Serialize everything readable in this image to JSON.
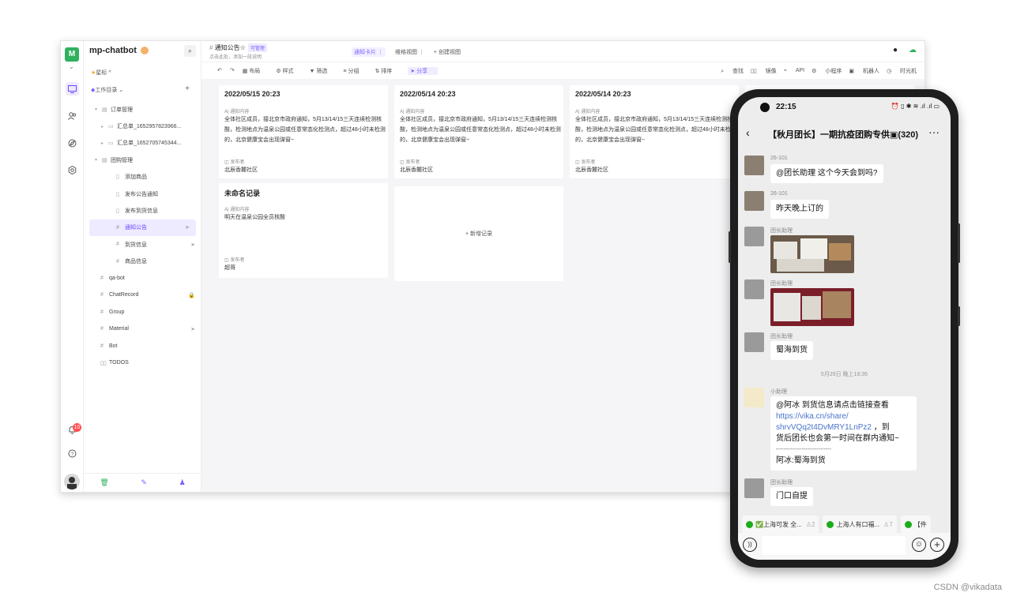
{
  "app": {
    "space_name": "mp-chatbot",
    "logo_letter": "M",
    "star_label": "星标 ^",
    "workdir_label": "工作目录",
    "notification_count": "10"
  },
  "tree": [
    {
      "label": "订单管理",
      "level": 1,
      "expand": "▾",
      "icon": "▤"
    },
    {
      "label": "汇总单_1652957823966...",
      "level": 2,
      "expand": "▸",
      "icon": "▭"
    },
    {
      "label": "汇总单_1652705745344...",
      "level": 2,
      "expand": "▸",
      "icon": "▭"
    },
    {
      "label": "团购管理",
      "level": 1,
      "expand": "▾",
      "icon": "▤"
    },
    {
      "label": "添加商品",
      "level": 3,
      "expand": "",
      "icon": "▯"
    },
    {
      "label": "发布公告通知",
      "level": 3,
      "expand": "",
      "icon": "▯"
    },
    {
      "label": "发布到货信息",
      "level": 3,
      "expand": "",
      "icon": "▯"
    },
    {
      "label": "通知公告",
      "level": 3,
      "expand": "",
      "icon": "#",
      "active": true,
      "tail": "➤"
    },
    {
      "label": "到货信息",
      "level": 3,
      "expand": "",
      "icon": "#",
      "tail": "➤"
    },
    {
      "label": "商品信息",
      "level": 3,
      "expand": "",
      "icon": "#"
    },
    {
      "label": "qa-bot",
      "level": 0,
      "expand": "",
      "icon": "#"
    },
    {
      "label": "ChatRecord",
      "level": 0,
      "expand": "",
      "icon": "#",
      "tail": "🔒"
    },
    {
      "label": "Group",
      "level": 0,
      "expand": "",
      "icon": "#"
    },
    {
      "label": "Material",
      "level": 0,
      "expand": "",
      "icon": "#",
      "tail": "➤"
    },
    {
      "label": "Bot",
      "level": 0,
      "expand": "",
      "icon": "#"
    },
    {
      "label": "TODOS",
      "level": 0,
      "expand": "",
      "icon": "▯▯"
    }
  ],
  "header": {
    "title": "通知公告☆",
    "tag": "可管理",
    "desc": "点击此处，添加一段说明",
    "tabs": [
      "通知卡片 ⋮",
      "维格视图 ⋮",
      "+ 创建视图"
    ]
  },
  "toolbar": {
    "left": [
      "↶",
      "↷",
      "布局",
      "样式",
      "筛选",
      "分组",
      "排序",
      "分享"
    ],
    "right": [
      "查找",
      "镜像",
      "API",
      "小程序",
      "机器人",
      "时光机"
    ]
  },
  "cards": [
    {
      "title": "2022/05/15 20:23",
      "content_label": "通知内容",
      "content": "全体社区成员，接北京市政府通知，5月13/14/15三天连续检测核酸，检测地点为温泉公园或任意常态化检测点，超过48小时未检测的，北京健康宝会出现弹窗~",
      "pub_label": "发布者",
      "pub": "北辰香麓社区"
    },
    {
      "title": "2022/05/14 20:23",
      "content_label": "通知内容",
      "content": "全体社区成员，接北京市政府通知，5月13/14/15三天连续检测核酸，检测地点为温泉公园或任意常态化检测点，超过48小时未检测的，北京健康宝会出现弹窗~",
      "pub_label": "发布者",
      "pub": "北辰香麓社区"
    },
    {
      "title": "2022/05/14 20:23",
      "content_label": "通知内容",
      "content": "全体社区成员，接北京市政府通知，5月13/14/15三天连续检测核酸，检测地点为温泉公园或任意常态化检测点，超过48小时未检测的，北京健康宝会出现弹窗~",
      "pub_label": "发布者",
      "pub": "北辰香麓社区"
    },
    {
      "title": "未命名记录",
      "content_label": "通知内容",
      "content": "明天在温泉公园全员核酸",
      "pub_label": "发布者",
      "pub": "超哥"
    }
  ],
  "add_record": "+ 新增记录",
  "phone": {
    "time": "22:15",
    "status_right": "⏰ ▯ ✱ ≋ .ıl .ıl ▭",
    "chat_title": "【秋月团长】一期抗疫团购专供▣(320)",
    "messages": [
      {
        "name": "26-101",
        "text": "@团长助理  这个今天会到吗?"
      },
      {
        "name": "26-101",
        "text": "昨天晚上订的"
      },
      {
        "name": "团长助理",
        "text": ""
      },
      {
        "name": "团长助理",
        "text": ""
      },
      {
        "name": "团长助理",
        "text": "蜀海到货"
      },
      {
        "name": "小助理",
        "text": ""
      },
      {
        "name": "团长助理",
        "text": "门口自提"
      }
    ],
    "timestamp": "5月29日 晚上18:36",
    "long_msg": {
      "l1": "@阿冰 到货信息请点击链接查看",
      "link1": "https://vika.cn/share/",
      "link2": "shrvVQq2t4DvMRY1LnPz2",
      "l2tail": " ，到",
      "l3": "货后团长也会第一时间在群内通知~",
      "l4": "------------------------------",
      "l5": "阿冰:蜀海到货"
    },
    "quick": [
      {
        "label": "✅上海可发 全...",
        "count": "♙2"
      },
      {
        "label": "上海人有口福...",
        "count": "♙7"
      },
      {
        "label": "【件",
        "count": ""
      }
    ]
  },
  "watermark": "CSDN @vikadata"
}
